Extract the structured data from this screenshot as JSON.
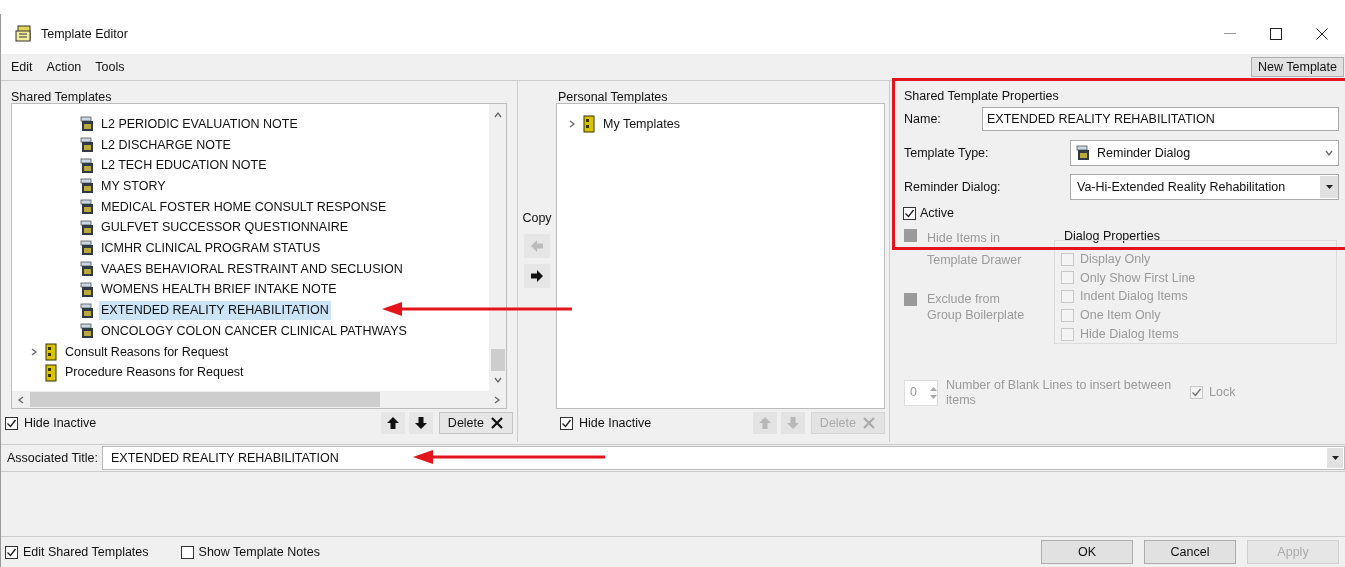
{
  "window": {
    "title": "Template Editor"
  },
  "menu": [
    "Edit",
    "Action",
    "Tools"
  ],
  "new_template_button": "New Template",
  "shared": {
    "label": "Shared Templates",
    "tree": [
      {
        "kind": "group",
        "children": [
          {
            "label": "L2 PERIODIC EVALUATION NOTE",
            "kind": "template",
            "selected": false
          },
          {
            "label": "L2 DISCHARGE NOTE",
            "kind": "template",
            "selected": false
          },
          {
            "label": "L2 TECH EDUCATION NOTE",
            "kind": "template",
            "selected": false
          },
          {
            "label": "MY STORY",
            "kind": "template",
            "selected": false
          },
          {
            "label": "MEDICAL FOSTER HOME CONSULT RESPONSE",
            "kind": "template",
            "selected": false
          },
          {
            "label": "GULFVET SUCCESSOR QUESTIONNAIRE",
            "kind": "template",
            "selected": false
          },
          {
            "label": "ICMHR CLINICAL PROGRAM STATUS",
            "kind": "template",
            "selected": false
          },
          {
            "label": "VAAES BEHAVIORAL RESTRAINT AND SECLUSION",
            "kind": "template",
            "selected": false
          },
          {
            "label": "WOMENS HEALTH BRIEF INTAKE NOTE",
            "kind": "template",
            "selected": false
          },
          {
            "label": "EXTENDED REALITY REHABILITATION",
            "kind": "template",
            "selected": true
          },
          {
            "label": "ONCOLOGY COLON CANCER CLINICAL PATHWAYS",
            "kind": "template",
            "selected": false
          }
        ]
      },
      {
        "label": "Consult Reasons for Request",
        "kind": "folder",
        "selected": false,
        "expandable": true
      },
      {
        "label": "Procedure Reasons for Request",
        "kind": "folder",
        "selected": false,
        "expandable": false
      }
    ],
    "hide_inactive": {
      "label": "Hide Inactive",
      "checked": true
    },
    "delete_button": {
      "label": "Delete",
      "disabled": false
    },
    "move_buttons_disabled": false
  },
  "copy": {
    "label": "Copy",
    "left_disabled": true,
    "right_disabled": false
  },
  "personal": {
    "label": "Personal Templates",
    "tree": [
      {
        "label": "My Templates",
        "kind": "folder",
        "selected": false,
        "expandable": true
      }
    ],
    "hide_inactive": {
      "label": "Hide Inactive",
      "checked": true
    },
    "delete_button": {
      "label": "Delete",
      "disabled": true
    },
    "move_buttons_disabled": true
  },
  "properties": {
    "title": "Shared Template Properties",
    "name": {
      "label": "Name:",
      "value": "EXTENDED REALITY REHABILITATION"
    },
    "template_type": {
      "label": "Template Type:",
      "value": "Reminder Dialog"
    },
    "reminder_dialog": {
      "label": "Reminder Dialog:",
      "value": "Va-Hi-Extended Reality Rehabilitation"
    },
    "active": {
      "label": "Active",
      "checked": true,
      "disabled": false
    },
    "hide_items": {
      "label": "Hide Items in Template Drawer",
      "checked": false,
      "grayed": true,
      "disabled": true
    },
    "exclude": {
      "label": "Exclude from Group Boilerplate",
      "checked": false,
      "grayed": true,
      "disabled": true
    },
    "dialog_properties": {
      "title": "Dialog Properties",
      "options": [
        {
          "label": "Display Only",
          "checked": false,
          "disabled": true
        },
        {
          "label": "Only Show First Line",
          "checked": false,
          "disabled": true
        },
        {
          "label": "Indent Dialog Items",
          "checked": false,
          "disabled": true
        },
        {
          "label": "One Item Only",
          "checked": false,
          "disabled": true
        },
        {
          "label": "Hide Dialog Items",
          "checked": false,
          "disabled": true
        }
      ]
    },
    "blank_lines": {
      "value": "0",
      "label": "Number of Blank Lines to insert between items",
      "disabled": true
    },
    "lock": {
      "label": "Lock",
      "checked": true,
      "disabled": true
    }
  },
  "associated_title": {
    "label": "Associated Title:",
    "value": "EXTENDED REALITY REHABILITATION"
  },
  "footer": {
    "edit_shared": {
      "label": "Edit Shared Templates",
      "checked": true
    },
    "show_notes": {
      "label": "Show Template Notes",
      "checked": false
    },
    "buttons": [
      {
        "label": "OK",
        "disabled": false
      },
      {
        "label": "Cancel",
        "disabled": false
      },
      {
        "label": "Apply",
        "disabled": true
      }
    ]
  }
}
